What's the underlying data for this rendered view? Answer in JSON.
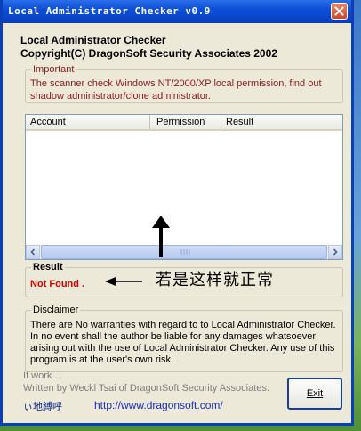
{
  "window": {
    "title": "Local Administrator Checker v0.9"
  },
  "header": {
    "line1": "Local Administrator Checker",
    "line2": "Copyright(C) DragonSoft Security Associates 2002"
  },
  "important": {
    "label": "Important",
    "text": "The scanner check Windows NT/2000/XP local permission, find out shadow administrator/clone administrator."
  },
  "table": {
    "columns": [
      "Account",
      "Permission",
      "Result"
    ],
    "rows": []
  },
  "result": {
    "label": "Result",
    "value": "Not Found ."
  },
  "annotation": {
    "text": "若是这样就正常"
  },
  "disclaimer": {
    "label": "Disclaimer",
    "text": "There are No warranties with regard to to Local Administrator Checker. In no event shall the author be liable for any damages whatsoever arising out with the use of Local Administrator Checker. Any use of this program is at the user's own risk."
  },
  "footer": {
    "status1": "If work ...",
    "status2": "Written by Weckl Tsai of DragonSoft Security Associates.",
    "credit": "ぃ地縛呼",
    "url": "http://www.dragonsoft.com/",
    "exit_label": "Exit"
  },
  "colors": {
    "title_bar": "#0842c4",
    "important_text": "#8b1a1a",
    "result_value": "#cc0000",
    "link": "#1a2dbd"
  }
}
